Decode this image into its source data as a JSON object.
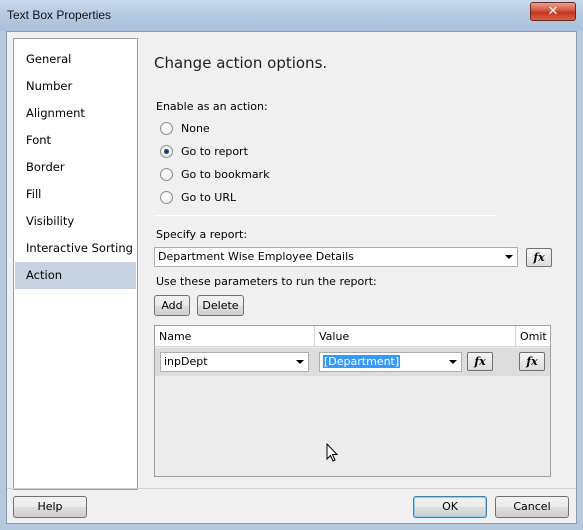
{
  "window": {
    "title": "Text Box Properties",
    "close_glyph": "✕"
  },
  "nav": {
    "items": [
      {
        "label": "General"
      },
      {
        "label": "Number"
      },
      {
        "label": "Alignment"
      },
      {
        "label": "Font"
      },
      {
        "label": "Border"
      },
      {
        "label": "Fill"
      },
      {
        "label": "Visibility"
      },
      {
        "label": "Interactive Sorting"
      },
      {
        "label": "Action"
      }
    ],
    "selected": "Action"
  },
  "main": {
    "heading": "Change action options.",
    "enable_label": "Enable as an action:",
    "options": [
      {
        "label": "None",
        "checked": false
      },
      {
        "label": "Go to report",
        "checked": true
      },
      {
        "label": "Go to bookmark",
        "checked": false
      },
      {
        "label": "Go to URL",
        "checked": false
      }
    ],
    "report_label": "Specify a report:",
    "report_value": "Department Wise Employee Details",
    "params_label": "Use these parameters to run the report:",
    "add_label": "Add",
    "delete_label": "Delete",
    "fx_label": "fx",
    "grid": {
      "columns": [
        "Name",
        "Value",
        "Omit"
      ],
      "rows": [
        {
          "name": "inpDept",
          "value": "[Department]"
        }
      ]
    }
  },
  "footer": {
    "help_label": "Help",
    "ok_label": "OK",
    "cancel_label": "Cancel"
  },
  "colors": {
    "selection": "#3399ff",
    "nav_selected": "#c6d2e0",
    "close_button": "#c2361f"
  }
}
